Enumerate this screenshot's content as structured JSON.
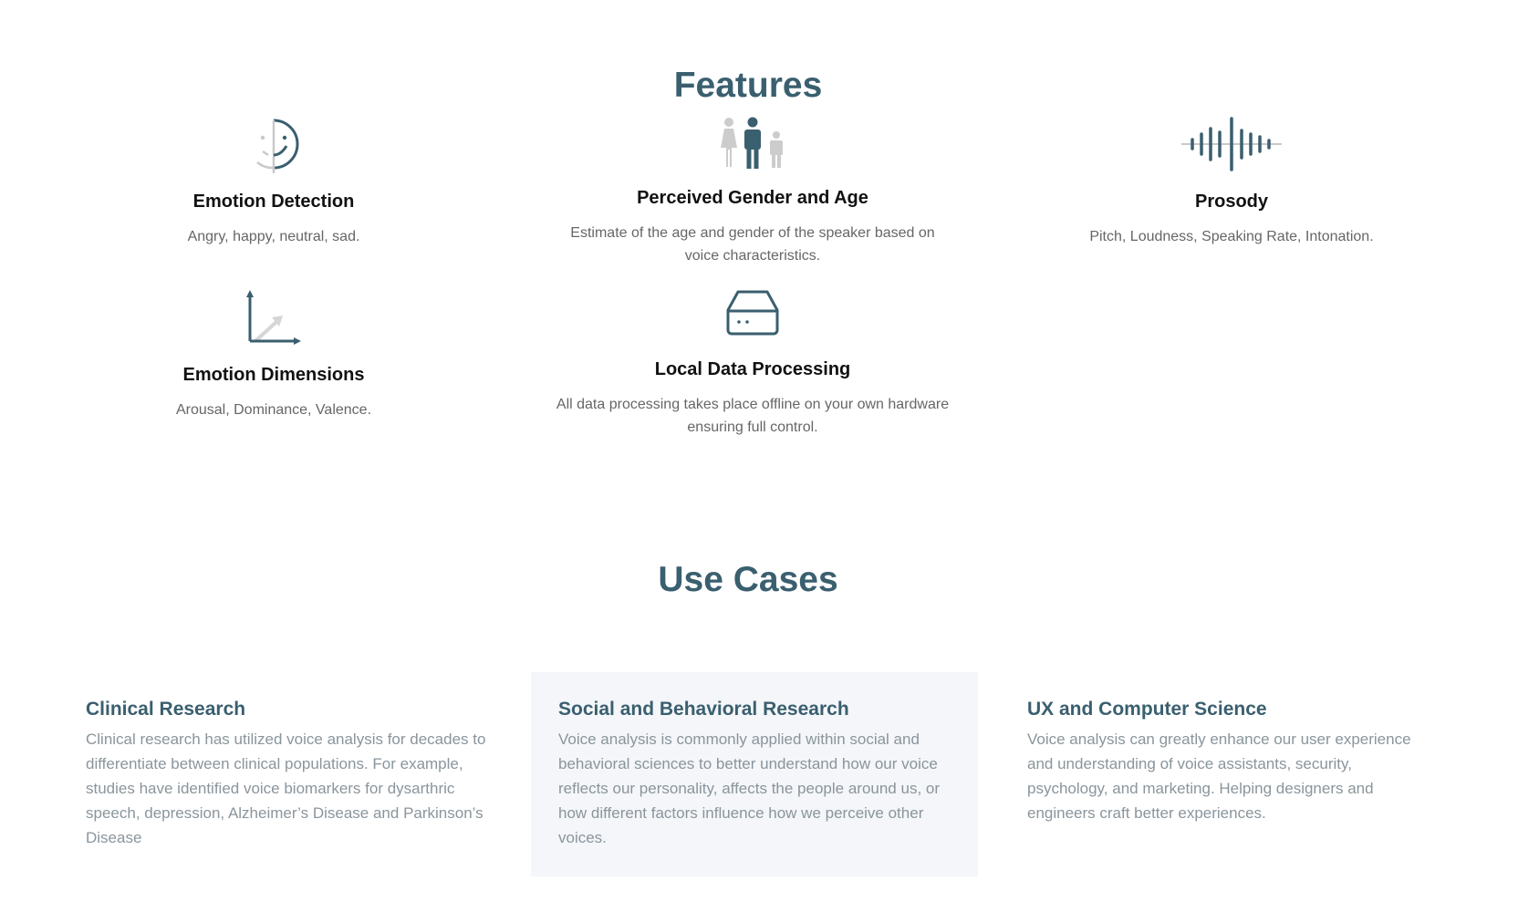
{
  "features": {
    "title": "Features",
    "items": [
      {
        "icon": "emotion-face-icon",
        "title": "Emotion Detection",
        "description": "Angry, happy, neutral, sad."
      },
      {
        "icon": "people-icon",
        "title": "Perceived Gender and Age",
        "description": "Estimate of the age and gender of the speaker based on voice characteristics."
      },
      {
        "icon": "sound-wave-icon",
        "title": "Prosody",
        "description": "Pitch, Loudness, Speaking Rate, Intonation."
      },
      {
        "icon": "axis-chart-icon",
        "title": "Emotion Dimensions",
        "description": "Arousal, Dominance, Valence."
      },
      {
        "icon": "hard-drive-icon",
        "title": "Local Data Processing",
        "description": "All data processing takes place offline on your own hardware ensuring full control."
      }
    ]
  },
  "use_cases": {
    "title": "Use Cases",
    "items": [
      {
        "title": "Clinical Research",
        "description": "Clinical research has utilized voice analysis for decades to differentiate between clinical populations. For example, studies have identified voice biomarkers for dysarthric speech, depression, Alzheimer’s Disease and Parkinson’s Disease"
      },
      {
        "title": "Social and Behavioral Research",
        "description": "Voice analysis is commonly applied within social and behavioral sciences to better understand how our voice reflects our personality, affects the people around us, or how different factors influence how we perceive other voices."
      },
      {
        "title": "UX and Computer Science",
        "description": "Voice analysis can greatly enhance our user experience and understanding of voice assistants, security, psychology, and marketing. Helping designers and engineers craft better experiences."
      }
    ]
  },
  "colors": {
    "accent": "#3a5f6f",
    "muted_icon": "#c9c9c9",
    "heading_text": "#111111",
    "body_text": "#666666",
    "use_case_text": "#8a959c",
    "highlight_bg": "#f4f6f9"
  }
}
